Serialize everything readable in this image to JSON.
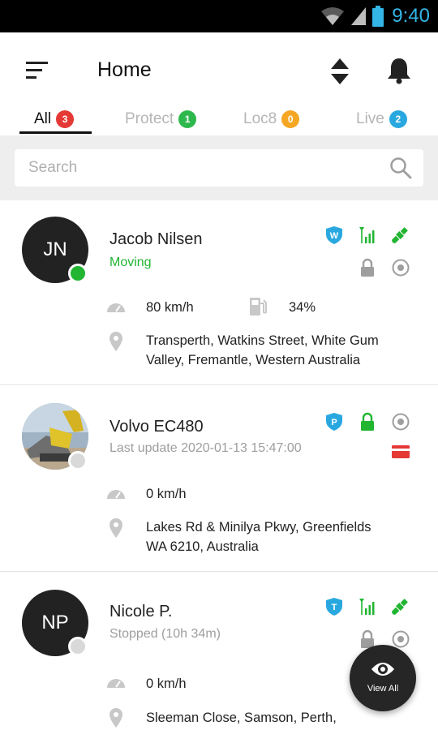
{
  "status_bar": {
    "time": "9:40",
    "icons": [
      "wifi-icon",
      "cell-signal-icon",
      "battery-icon"
    ]
  },
  "app_bar": {
    "title": "Home",
    "icons": [
      "menu-icon",
      "sort-icon",
      "bell-icon"
    ]
  },
  "tabs": [
    {
      "label": "All",
      "count": "3",
      "badge_color": "#e53935",
      "active": true
    },
    {
      "label": "Protect",
      "count": "1",
      "badge_color": "#2db84d",
      "active": false
    },
    {
      "label": "Loc8",
      "count": "0",
      "badge_color": "#f5a623",
      "active": false
    },
    {
      "label": "Live",
      "count": "2",
      "badge_color": "#29a8e0",
      "active": false
    }
  ],
  "search": {
    "placeholder": "Search"
  },
  "assets": [
    {
      "initials": "JN",
      "name": "Jacob Nilsen",
      "status": "Moving",
      "status_color": "#21b532",
      "dot_color": "#21b532",
      "speed": "80 km/h",
      "fuel": "34%",
      "address_line1": "Transperth, Watkins Street, White Gum",
      "address_line2": "Valley, Fremantle, Western Australia",
      "badge_letter": "W",
      "icons": [
        "shield-w-icon",
        "signal-icon",
        "satellite-icon",
        "lock-icon",
        "target-icon"
      ]
    },
    {
      "initials": "",
      "name": "Volvo EC480",
      "status": "Last update 2020-01-13 15:47:00",
      "status_color": "#9e9e9e",
      "dot_color": "#d9d9d9",
      "speed": "0 km/h",
      "address_line1": "Lakes Rd & Minilya Pkwy, Greenfields",
      "address_line2": "WA 6210, Australia",
      "badge_letter": "P",
      "icons": [
        "shield-p-icon",
        "lock-icon",
        "target-icon",
        "card-icon"
      ]
    },
    {
      "initials": "NP",
      "name": "Nicole P.",
      "status": "Stopped (10h 34m)",
      "status_color": "#9e9e9e",
      "dot_color": "#d9d9d9",
      "speed": "0 km/h",
      "address_line1": "Sleeman Close, Samson, Perth,",
      "badge_letter": "T",
      "icons": [
        "shield-t-icon",
        "signal-icon",
        "satellite-icon",
        "lock-icon",
        "target-icon"
      ]
    }
  ],
  "fab": {
    "label": "View All",
    "icon": "eye-icon"
  },
  "colors": {
    "accent_blue": "#29a8e0",
    "green": "#21b532",
    "red": "#e53935",
    "grey_icon": "#9e9e9e"
  }
}
